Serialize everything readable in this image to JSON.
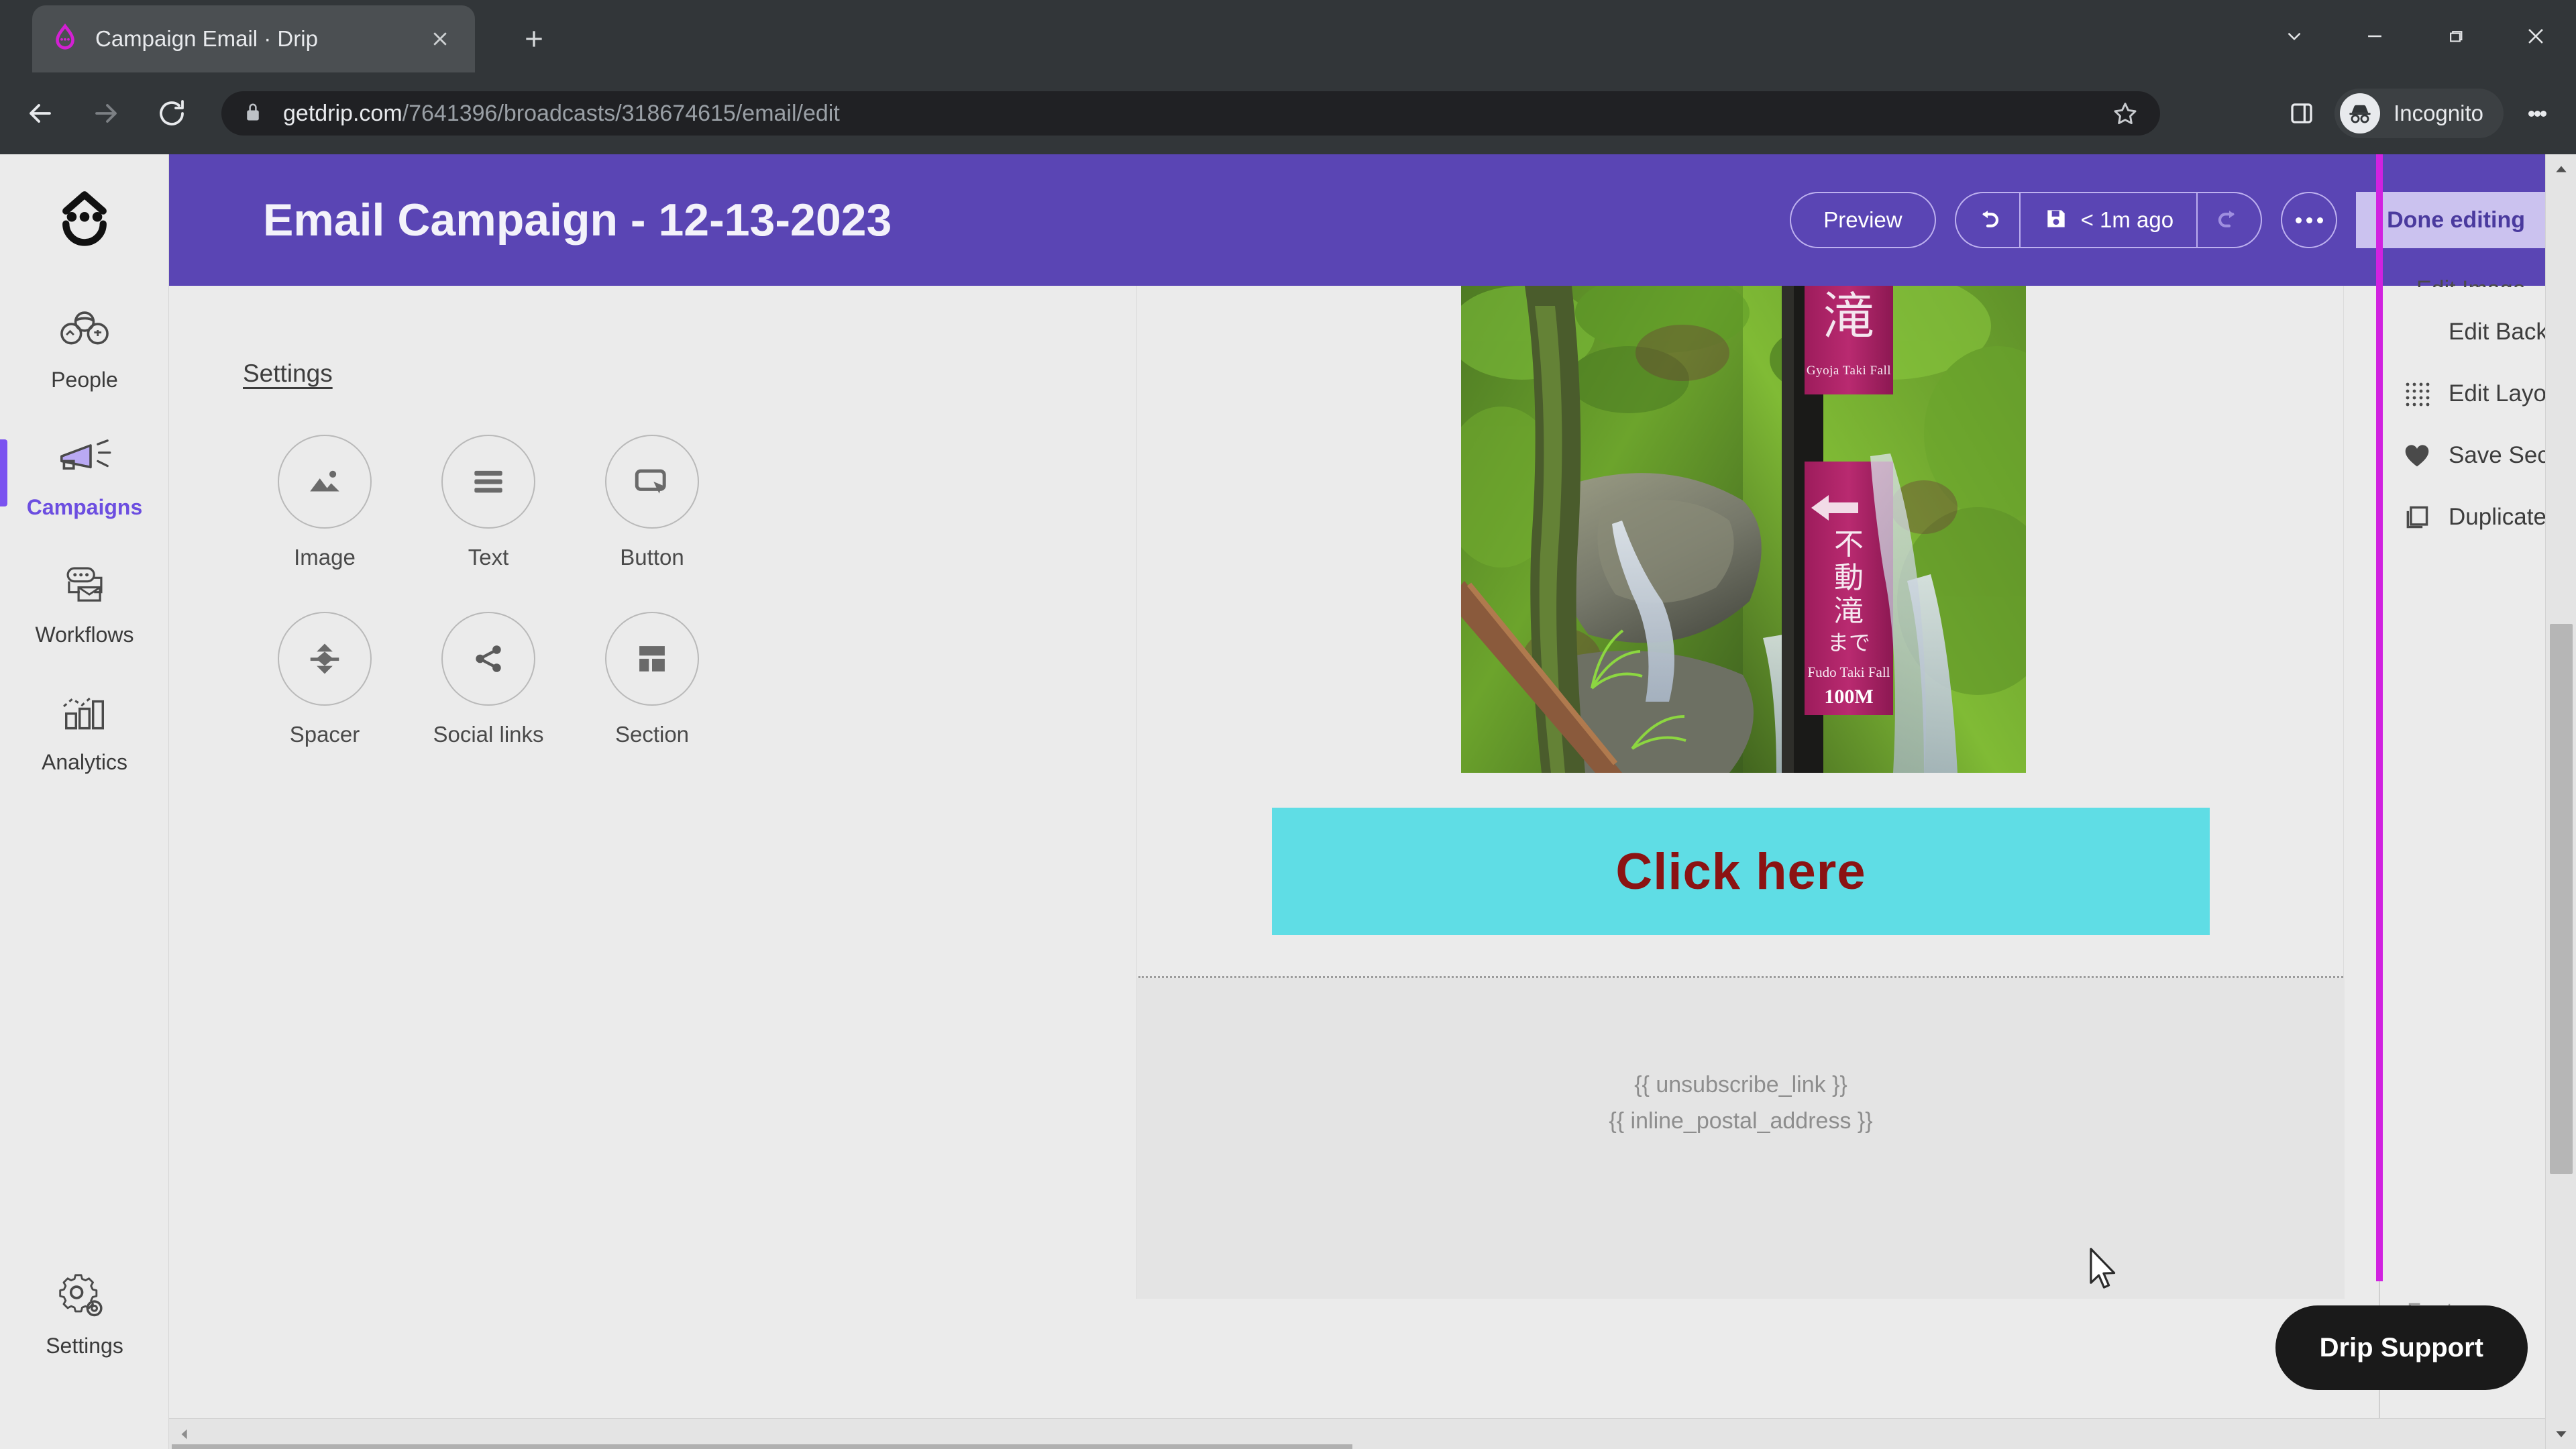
{
  "browser": {
    "tab": {
      "title": "Campaign Email · Drip",
      "favicon": "drip-logo-icon",
      "close": "close-icon"
    },
    "new_tab": "+",
    "window_controls": [
      "minimize-chevron-icon",
      "minimize-icon",
      "maximize-icon",
      "close-icon"
    ],
    "nav": {
      "back": "back-arrow-icon",
      "forward": "forward-arrow-icon",
      "reload": "reload-icon"
    },
    "omnibox": {
      "lock": "lock-icon",
      "host": "getdrip.com",
      "path": "/7641396/broadcasts/318674615/email/edit",
      "full_url": "getdrip.com/7641396/broadcasts/318674615/email/edit",
      "bookmark": "star-icon"
    },
    "toolbar_right": {
      "side_panel": "side-panel-icon",
      "profile_icon": "incognito-icon",
      "profile_label": "Incognito",
      "menu": "kebab-menu-icon"
    }
  },
  "sidebar": {
    "logo": "drip-smiley-logo",
    "items": [
      {
        "label": "People",
        "icon": "people-icon",
        "active": false
      },
      {
        "label": "Campaigns",
        "icon": "megaphone-icon",
        "active": true
      },
      {
        "label": "Workflows",
        "icon": "workflow-icon",
        "active": false
      },
      {
        "label": "Analytics",
        "icon": "bar-chart-icon",
        "active": false
      }
    ],
    "bottom": {
      "label": "Settings",
      "icon": "gear-icon"
    }
  },
  "header": {
    "title": "Email Campaign - 12-13-2023",
    "preview_label": "Preview",
    "undo_icon": "undo-icon",
    "save_icon": "save-disk-icon",
    "save_label": "< 1m ago",
    "redo_icon": "redo-icon",
    "more_label": "...",
    "done_label": "Done editing",
    "bg_color": "#5a45b4",
    "done_bg_color": "#cbc2ef",
    "done_text_color": "#4a3a9e"
  },
  "palette": {
    "title": "Settings",
    "items": [
      {
        "label": "Image",
        "icon": "image-icon"
      },
      {
        "label": "Text",
        "icon": "text-lines-icon"
      },
      {
        "label": "Button",
        "icon": "button-cursor-icon"
      },
      {
        "label": "Spacer",
        "icon": "spacer-arrows-icon"
      },
      {
        "label": "Social links",
        "icon": "share-icon"
      },
      {
        "label": "Section",
        "icon": "section-layout-icon"
      }
    ]
  },
  "canvas": {
    "image": {
      "alt": "Japanese waterfall trail signpost in mossy green gorge",
      "sign_top_kanji": "滝",
      "sign_top_romaji": "Gyoja Taki Fall",
      "sign_bottom_kanji": "不動滝まで",
      "sign_bottom_romaji": "Fudo Taki Fall",
      "sign_bottom_distance": "100M",
      "arrow": "left-arrow-icon"
    },
    "cta": {
      "label": "Click here",
      "bg_color": "#5fdde5",
      "text_color": "#8b1313"
    },
    "footer": {
      "unsubscribe": "{{ unsubscribe_link }}",
      "postal_address": "{{ inline_postal_address }}"
    }
  },
  "inspector": {
    "cut_label": "Edit Image",
    "accent_color": "#d122e0",
    "items": [
      {
        "label": "Edit Background",
        "icon": ""
      },
      {
        "label": "Edit Layout",
        "icon": "grid-dots-icon"
      },
      {
        "label": "Save Section",
        "icon": "heart-icon"
      },
      {
        "label": "Duplicate",
        "icon": "duplicate-icon"
      }
    ],
    "footer_tag": "Footer"
  },
  "support": {
    "label": "Drip Support"
  },
  "scrollbars": {
    "vertical": {
      "up": "chevron-up-icon",
      "down": "chevron-down-icon"
    },
    "horizontal": {
      "left": "chevron-left-icon"
    }
  },
  "cursor": {
    "icon": "mouse-pointer-icon"
  }
}
